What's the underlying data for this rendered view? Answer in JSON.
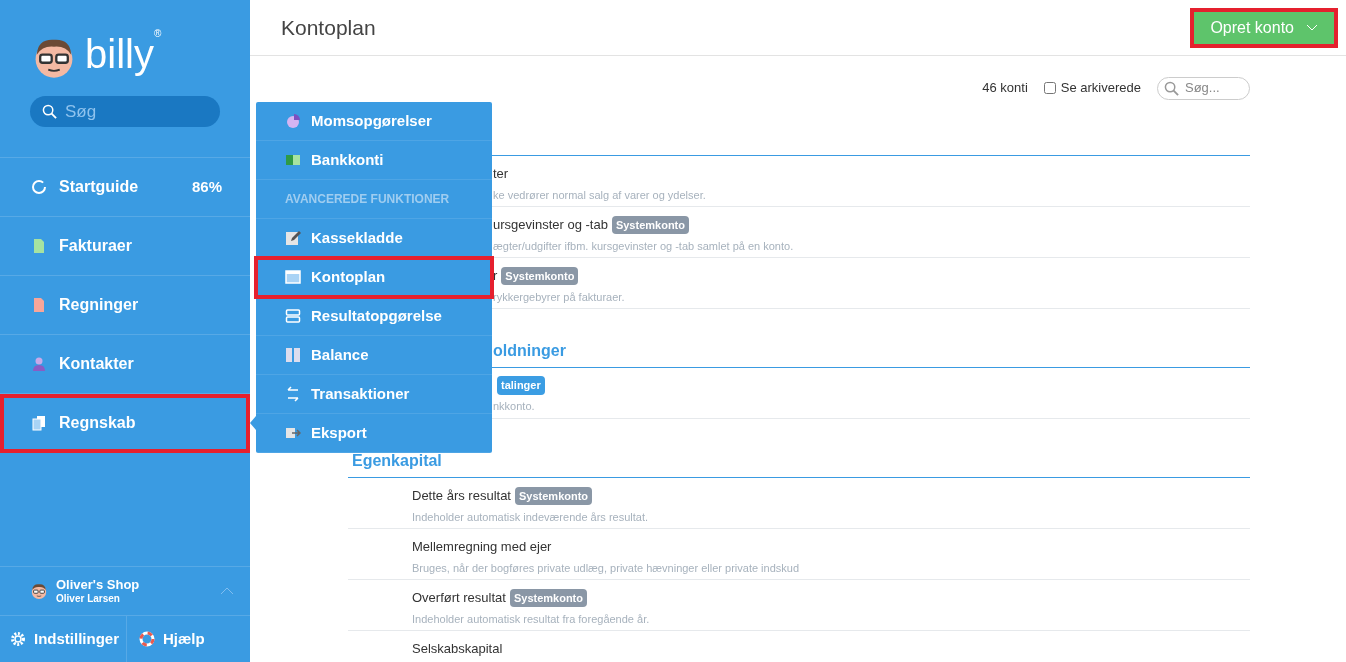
{
  "sidebar": {
    "logo": "billy",
    "logo_mark": "®",
    "search": {
      "placeholder": "Søg"
    },
    "items": [
      {
        "label": "Startguide",
        "value": "86%",
        "highlighted": false
      },
      {
        "label": "Fakturaer",
        "highlighted": false
      },
      {
        "label": "Regninger",
        "highlighted": false
      },
      {
        "label": "Kontakter",
        "highlighted": false
      },
      {
        "label": "Regnskab",
        "highlighted": true
      }
    ],
    "user": {
      "company": "Oliver's Shop",
      "name": "Oliver Larsen"
    },
    "footer": [
      {
        "label": "Indstillinger"
      },
      {
        "label": "Hjælp"
      }
    ]
  },
  "menu": [
    {
      "kind": "item",
      "label": "Momsopgørelser",
      "highlighted": false
    },
    {
      "kind": "item",
      "label": "Bankkonti",
      "highlighted": false
    },
    {
      "kind": "header",
      "label": "AVANCEREDE FUNKTIONER"
    },
    {
      "kind": "item",
      "label": "Kassekladde",
      "highlighted": false
    },
    {
      "kind": "item",
      "label": "Kontoplan",
      "highlighted": true
    },
    {
      "kind": "item",
      "label": "Resultatopgørelse",
      "highlighted": false
    },
    {
      "kind": "item",
      "label": "Balance",
      "highlighted": false
    },
    {
      "kind": "item",
      "label": "Transaktioner",
      "highlighted": false
    },
    {
      "kind": "item",
      "label": "Eksport",
      "highlighted": false
    }
  ],
  "header": {
    "title": "Kontoplan",
    "button": {
      "label": "Opret konto",
      "highlighted": true
    }
  },
  "toolbar": {
    "count": "46 konti",
    "archived": {
      "label": "Se arkiverede",
      "checked": false
    },
    "search": {
      "placeholder": "Søg..."
    }
  },
  "sections": [
    {
      "kind": "partial",
      "rows": [
        {
          "kind": "partial",
          "name": "ter",
          "description": "ke vedrører normal salg af varer og ydelser."
        },
        {
          "kind": "partial",
          "name": "ursgevinster og -tab",
          "badge": {
            "label": "Systemkonto",
            "kind": "system"
          },
          "description": "ægter/udgifter ifbm. kursgevinster og -tab samlet på en konto."
        },
        {
          "kind": "partial",
          "name": "r",
          "badge": {
            "label": "Systemkonto",
            "kind": "system"
          },
          "description": "rykkergebyrer på fakturaer."
        }
      ]
    },
    {
      "kind": "partial",
      "title": "oldninger",
      "rows": [
        {
          "kind": "partial",
          "badge": {
            "label": "talinger",
            "kind": "bank"
          },
          "description": "nkkonto."
        }
      ]
    },
    {
      "kind": "group",
      "title": "Egenkapital",
      "rows": [
        {
          "kind": "account",
          "name": "Dette års resultat",
          "badge": {
            "label": "Systemkonto",
            "kind": "system"
          },
          "description": "Indeholder automatisk indeværende års resultat."
        },
        {
          "kind": "account",
          "name": "Mellemregning med ejer",
          "description": "Bruges, når der bogføres private udlæg, private hævninger eller private indskud"
        },
        {
          "kind": "account",
          "name": "Overført resultat",
          "badge": {
            "label": "Systemkonto",
            "kind": "system"
          },
          "description": "Indeholder automatisk resultat fra foregående år."
        },
        {
          "kind": "account",
          "name": "Selskabskapital"
        }
      ]
    }
  ]
}
